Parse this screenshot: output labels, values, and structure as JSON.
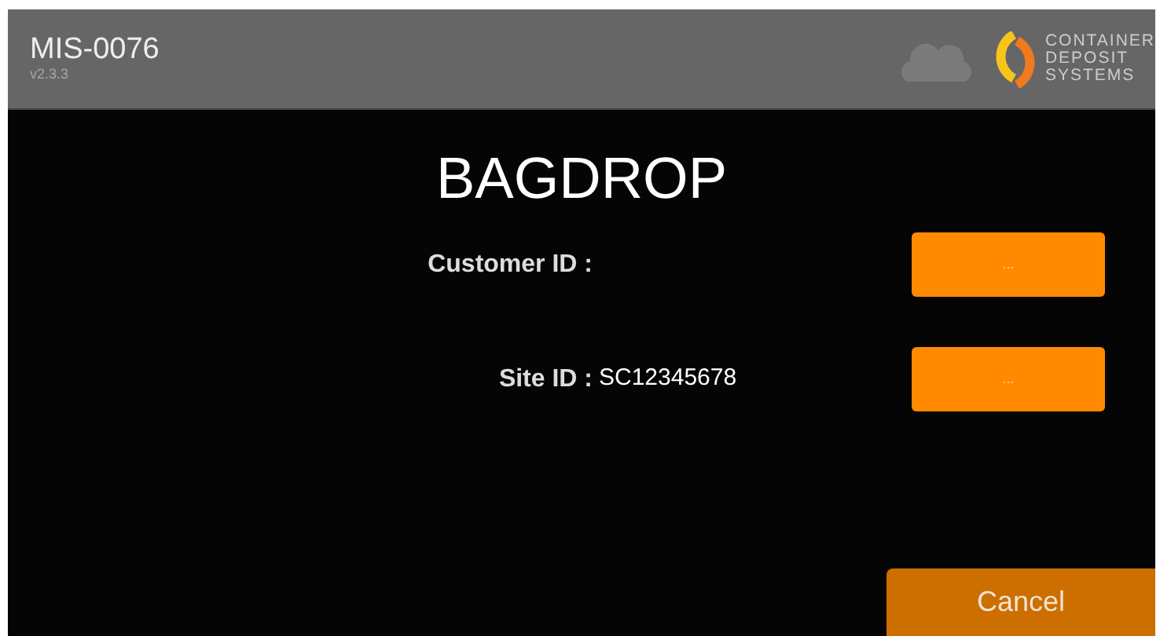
{
  "header": {
    "title": "MIS-0076",
    "version": "v2.3.3",
    "logo_text": [
      "CONTAINER",
      "DEPOSIT",
      "SYSTEMS"
    ]
  },
  "heading": "BAGDROP",
  "fields": [
    {
      "label": "Customer ID :",
      "button": "..."
    },
    {
      "label": "Site ID :",
      "value": "SC12345678",
      "button": "..."
    }
  ],
  "cancel_button": "Cancel"
}
